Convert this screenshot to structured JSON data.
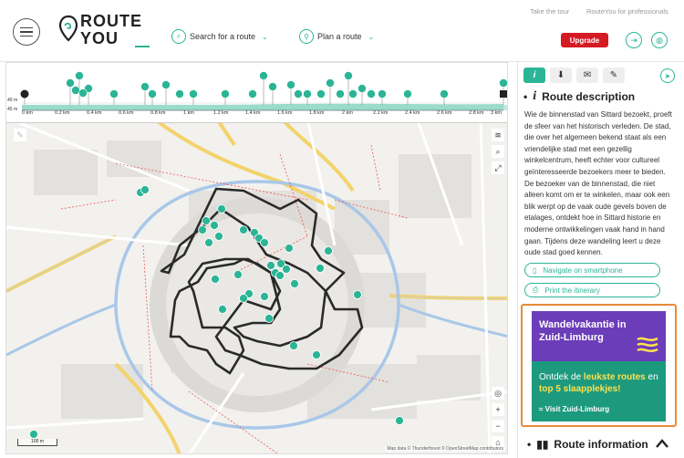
{
  "header": {
    "logo_line1": "ROUTE",
    "logo_line2": "YOU",
    "nav_search": "Search for a route",
    "nav_plan": "Plan a route",
    "take_tour": "Take the tour",
    "professionals": "RouteYou for professionals",
    "upgrade": "Upgrade",
    "icons": [
      "menu-icon",
      "search-icon",
      "pin-icon",
      "login-icon",
      "globe-icon"
    ]
  },
  "elevation": {
    "y_labels": [
      "49 m",
      "45 m"
    ],
    "x_ticks": [
      "0 km",
      "0.2 km",
      "0.4 km",
      "0.6 km",
      "0.8 km",
      "1 km",
      "1.2 km",
      "1.4 km",
      "1.6 km",
      "1.8 km",
      "2 km",
      "2.2 km",
      "2.4 km",
      "2.6 km",
      "2.8 km",
      "3 km"
    ]
  },
  "map": {
    "attribution": "Map data © Thunderforest © OpenStreetMap contributors",
    "scale_label": "100 m",
    "controls": [
      "layers-icon",
      "search-icon",
      "fullscreen-icon",
      "locate-icon",
      "zoom-in",
      "zoom-out",
      "home-icon"
    ],
    "zoom_in": "+",
    "zoom_out": "−"
  },
  "sidebar": {
    "tabs": [
      "i",
      "⬇",
      "✉",
      "✎"
    ],
    "title": "Route description",
    "description": "Wie de binnenstad van Sittard bezoekt, proeft de sfeer van het historisch verleden. De stad, die over het algemeen bekend staat als een vriendelijke stad met een gezellig winkelcentrum, heeft echter voor cultureel geïnteresseerde bezoekers meer te bieden. De bezoeker van de binnenstad, die niet alleen komt om er te winkelen, maar ook een blik werpt op de vaak oude gevels boven de etalages, ontdekt hoe in Sittard historie en moderne ontwikkelingen vaak hand in hand gaan. Tijdens deze wandeling leert u deze oude stad goed kennen.",
    "navigate": "Navigate on smartphone",
    "print": "Print the itinerary",
    "route_info": "Route information"
  },
  "ad": {
    "title": "Wandelvakantie in Zuid-Limburg",
    "body_pre": "Ontdek de ",
    "body_bold": "leukste routes",
    "body_mid": " en ",
    "body_bold2": "top 5 slaapplekjes!",
    "visit": "Visit Zuid-Limburg",
    "colors": {
      "top": "#6b3db8",
      "bottom": "#1d9a7e",
      "highlight": "#ffe14d"
    }
  },
  "colors": {
    "accent": "#2bb596",
    "upgrade": "#d41a23",
    "ad_border": "#e98a3a"
  }
}
